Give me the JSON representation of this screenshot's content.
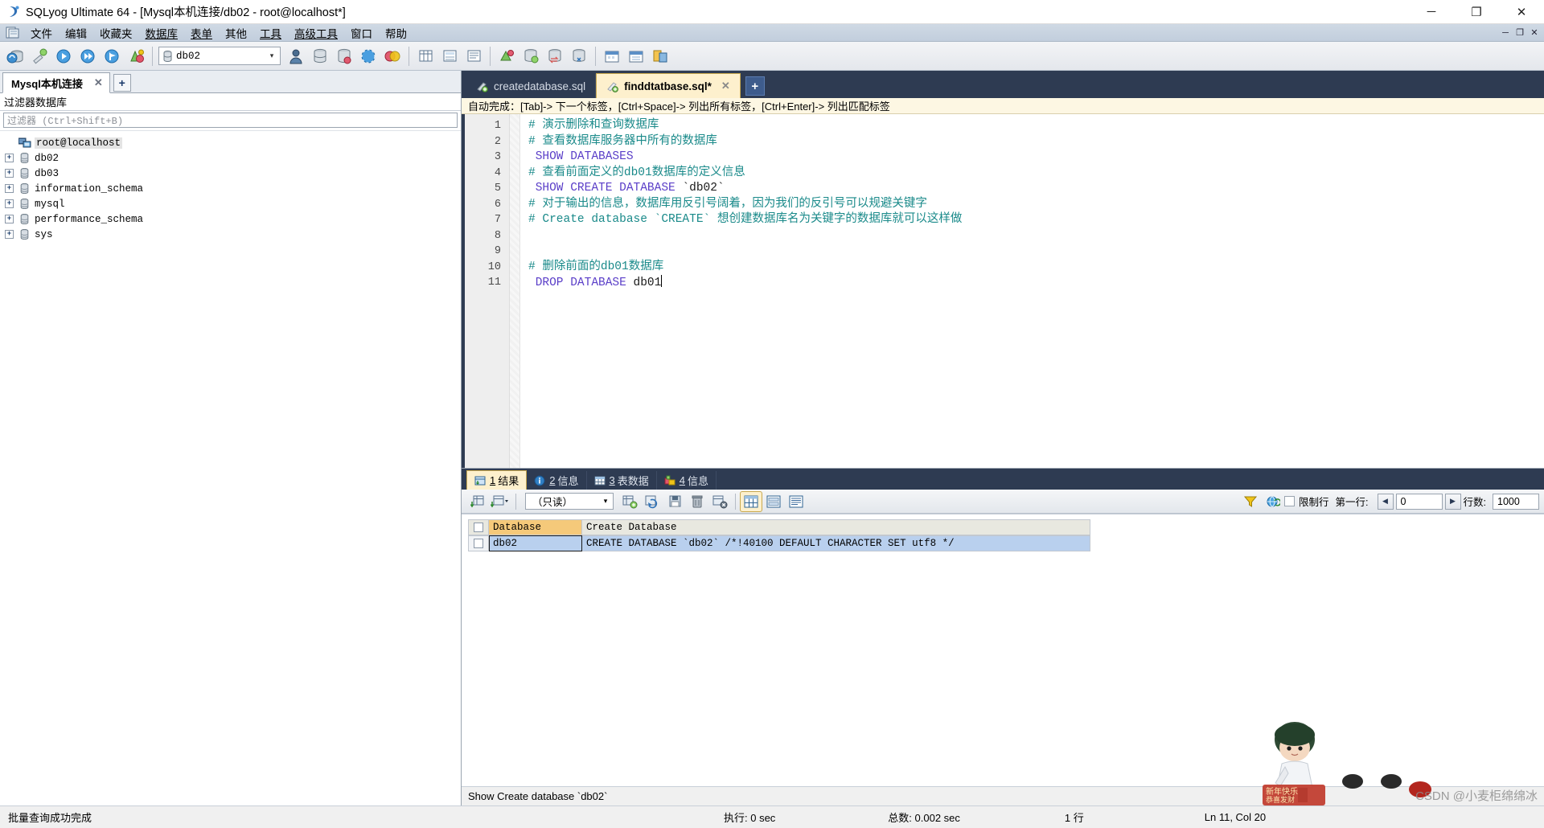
{
  "window": {
    "title": "SQLyog Ultimate 64 - [Mysql本机连接/db02 - root@localhost*]",
    "app_icon": "sqlyog-logo-icon",
    "minimize": "─",
    "maximize": "❐",
    "close": "✕"
  },
  "menubar": {
    "doc_icon": "document-icon",
    "items": [
      {
        "label": "文件"
      },
      {
        "label": "编辑"
      },
      {
        "label": "收藏夹"
      },
      {
        "label": "数据库"
      },
      {
        "label": "表单"
      },
      {
        "label": "其他"
      },
      {
        "label": "工具"
      },
      {
        "label": "高级工具"
      },
      {
        "label": "窗口"
      },
      {
        "label": "帮助"
      }
    ],
    "mdi": {
      "minimize": "─",
      "restore": "❐",
      "close": "✕"
    }
  },
  "toolbar": {
    "database_selector": {
      "value": "db02",
      "icon": "database-icon",
      "arrow": "▾"
    },
    "buttons": [
      {
        "name": "new-connection-button",
        "icon": "connect-icon"
      },
      {
        "name": "refresh-object-browser-button",
        "icon": "wand-icon"
      },
      {
        "name": "execute-query-button",
        "icon": "play-icon"
      },
      {
        "name": "execute-all-queries-button",
        "icon": "play-all-icon"
      },
      {
        "name": "stop-query-button",
        "icon": "stop-icon"
      },
      {
        "name": "new-table-button",
        "icon": "table-add-icon"
      },
      {
        "name": "open-file-button",
        "icon": "folder-icon"
      },
      {
        "name": "save-file-button",
        "icon": "save-icon"
      },
      {
        "name": "save-as-button",
        "icon": "save-as-icon"
      },
      {
        "name": "copy-button",
        "icon": "copy-icon"
      },
      {
        "name": "grid-view-button",
        "icon": "grid-icon"
      },
      {
        "name": "form-view-button",
        "icon": "form-icon"
      },
      {
        "name": "text-view-button",
        "icon": "text-icon"
      },
      {
        "name": "import-button",
        "icon": "import-icon"
      },
      {
        "name": "export-button",
        "icon": "export-icon"
      },
      {
        "name": "backup-button",
        "icon": "backup-icon"
      },
      {
        "name": "restore-button",
        "icon": "restore-icon"
      },
      {
        "name": "schema-designer-button",
        "icon": "schema-icon"
      },
      {
        "name": "query-builder-button",
        "icon": "builder-icon"
      },
      {
        "name": "scheduler-button",
        "icon": "calendar-icon"
      },
      {
        "name": "user-manager-button",
        "icon": "users-icon"
      },
      {
        "name": "sync-button",
        "icon": "sync-icon"
      }
    ]
  },
  "sidebar": {
    "connection_tab": {
      "label": "Mysql本机连接",
      "close": "✕"
    },
    "add_tab": "+",
    "panel_title": "过滤器数据库",
    "filter": {
      "placeholder": "过滤器 (Ctrl+Shift+B)",
      "value": ""
    },
    "tree": {
      "root": {
        "label": "root@localhost",
        "icon": "server-icon"
      },
      "nodes": [
        {
          "label": "db02",
          "icon": "database-icon",
          "expander": "+"
        },
        {
          "label": "db03",
          "icon": "database-icon",
          "expander": "+"
        },
        {
          "label": "information_schema",
          "icon": "database-icon",
          "expander": "+"
        },
        {
          "label": "mysql",
          "icon": "database-icon",
          "expander": "+"
        },
        {
          "label": "performance_schema",
          "icon": "database-icon",
          "expander": "+"
        },
        {
          "label": "sys",
          "icon": "database-icon",
          "expander": "+"
        }
      ]
    }
  },
  "editor": {
    "tabs": [
      {
        "label": "createdatabase.sql",
        "active": false,
        "icon": "sql-file-icon"
      },
      {
        "label": "finddtatbase.sql*",
        "active": true,
        "icon": "sql-file-icon",
        "close": "✕"
      }
    ],
    "add_tab": "+",
    "hint": "自动完成：[Tab]-> 下一个标签，[Ctrl+Space]-> 列出所有标签，[Ctrl+Enter]-> 列出匹配标签",
    "lines": [
      {
        "n": "1",
        "segments": [
          {
            "t": "# 演示删除和查询数据库",
            "c": "cm"
          }
        ]
      },
      {
        "n": "2",
        "segments": [
          {
            "t": "# 查看数据库服务器中所有的数据库",
            "c": "cm"
          }
        ]
      },
      {
        "n": "3",
        "segments": [
          {
            "t": " SHOW DATABASES",
            "c": "kw"
          }
        ]
      },
      {
        "n": "4",
        "segments": [
          {
            "t": "# 查看前面定义的db01数据库的定义信息",
            "c": "cm"
          }
        ]
      },
      {
        "n": "5",
        "segments": [
          {
            "t": " SHOW CREATE DATABASE ",
            "c": "kw"
          },
          {
            "t": "`db02`",
            "c": "id"
          }
        ]
      },
      {
        "n": "6",
        "segments": [
          {
            "t": "# 对于输出的信息，数据库用反引号阔着，因为我们的反引号可以规避关键字",
            "c": "cm"
          }
        ]
      },
      {
        "n": "7",
        "segments": [
          {
            "t": "# Create database `CREATE` 想创建数据库名为关键字的数据库就可以这样做",
            "c": "cm"
          }
        ]
      },
      {
        "n": "8",
        "segments": []
      },
      {
        "n": "9",
        "segments": []
      },
      {
        "n": "10",
        "segments": [
          {
            "t": "# 删除前面的db01数据库",
            "c": "cm"
          }
        ]
      },
      {
        "n": "11",
        "segments": [
          {
            "t": " DROP DATABASE ",
            "c": "kw"
          },
          {
            "t": "db01",
            "c": "id"
          }
        ]
      }
    ]
  },
  "results": {
    "tabs": [
      {
        "num": "1",
        "label": "结果",
        "icon": "result-grid-icon",
        "active": true
      },
      {
        "num": "2",
        "label": "信息",
        "icon": "info-icon",
        "active": false
      },
      {
        "num": "3",
        "label": "表数据",
        "icon": "table-data-icon",
        "active": false
      },
      {
        "num": "4",
        "label": "信息",
        "icon": "objects-icon",
        "active": false
      }
    ],
    "toolbar": {
      "mode_selector": {
        "value": "（只读）",
        "arrow": "▾"
      },
      "buttons": [
        {
          "name": "first-grid-button",
          "icon": "grid-next-icon"
        },
        {
          "name": "grid-options-button",
          "icon": "grid-dropdown-icon"
        },
        {
          "name": "insert-row-button",
          "icon": "row-add-icon"
        },
        {
          "name": "refresh-data-button",
          "icon": "refresh-icon"
        },
        {
          "name": "save-changes-button",
          "icon": "floppy-icon"
        },
        {
          "name": "delete-row-button",
          "icon": "trash-icon"
        },
        {
          "name": "discard-changes-button",
          "icon": "grid-cancel-icon"
        },
        {
          "name": "grid-view-toggle",
          "icon": "grid-view-icon"
        },
        {
          "name": "form-view-toggle",
          "icon": "form-view-icon"
        },
        {
          "name": "text-view-toggle",
          "icon": "text-view-icon"
        },
        {
          "name": "filter-button",
          "icon": "funnel-icon"
        },
        {
          "name": "refresh-button",
          "icon": "globe-refresh-icon"
        }
      ],
      "limit_label": "限制行",
      "first_row_label": "第一行:",
      "first_row_value": "0",
      "rows_label": "行数:",
      "rows_value": "1000",
      "prev_arrow": "◀",
      "next_arrow": "▶"
    },
    "grid": {
      "columns": [
        "Database",
        "Create Database"
      ],
      "rows": [
        [
          "db02",
          "CREATE DATABASE `db02` /*!40100 DEFAULT CHARACTER SET utf8 */"
        ]
      ]
    },
    "query_status": "Show Create database `db02`"
  },
  "statusbar": {
    "message": "批量查询成功完成",
    "exec_time": "执行: 0 sec",
    "total_time": "总数: 0.002 sec",
    "row_count": "1 行",
    "cursor": "Ln 11, Col 20",
    "watermark": "CSDN @小麦柜绵绵冰"
  },
  "colors": {
    "title_bar": "#ffffff",
    "menu_gradient_top": "#cfd9e4",
    "editor_tab_bar": "#2e3b52",
    "active_tab": "#fdf0cd",
    "active_tab_border": "#c9a94f",
    "comment": "#1a8a8a",
    "keyword": "#5a3ec8",
    "grid_header": "#e8e8e0",
    "grid_header_selected": "#f5c97a",
    "grid_row_selected": "#b9d0ee"
  }
}
